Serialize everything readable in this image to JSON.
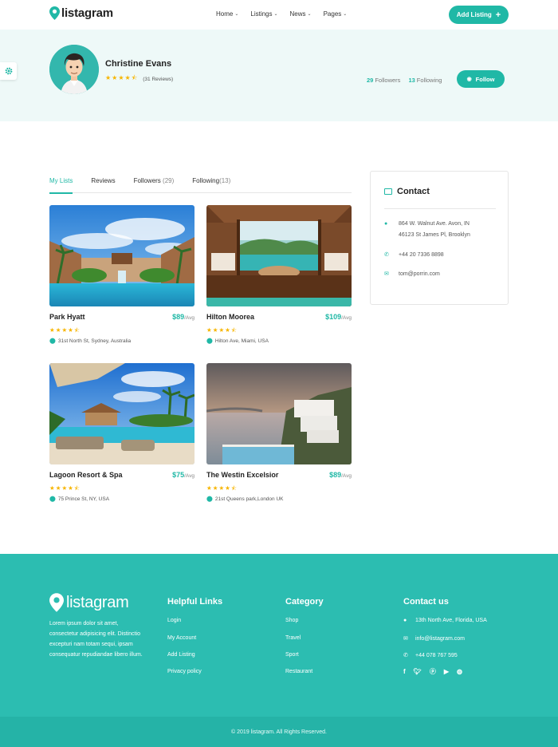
{
  "brand": {
    "name": "listagram",
    "accent": "#20b8a6"
  },
  "nav": {
    "items": [
      {
        "label": "Home"
      },
      {
        "label": "Listings"
      },
      {
        "label": "News"
      },
      {
        "label": "Pages"
      }
    ],
    "add_listing": "Add Listing"
  },
  "profile": {
    "name": "Christine Evans",
    "stars": "★★★★⯪",
    "reviews": "(31 Reviews)",
    "followers_count": "29",
    "followers_label": "Followers",
    "following_count": "13",
    "following_label": "Following",
    "follow_button": "Follow"
  },
  "tabs": [
    {
      "label": "My Lists",
      "count": ""
    },
    {
      "label": "Reviews",
      "count": ""
    },
    {
      "label": "Followers ",
      "count": "(29)"
    },
    {
      "label": "Following",
      "count": "(13)"
    }
  ],
  "listings": [
    {
      "title": "Park Hyatt",
      "price": "$89",
      "unit": "/Avg",
      "stars": "★★★★⯪",
      "address": "31st North St, Sydney, Australia"
    },
    {
      "title": "Hilton Moorea",
      "price": "$109",
      "unit": "/Avg",
      "stars": "★★★★⯪",
      "address": "Hilton Ave, Miami, USA"
    },
    {
      "title": "Lagoon Resort & Spa",
      "price": "$75",
      "unit": "/Avg",
      "stars": "★★★★⯪",
      "address": "75 Prince St, NY, USA"
    },
    {
      "title": "The Westin Excelsior",
      "price": "$89",
      "unit": "/Avg",
      "stars": "★★★★⯪",
      "address": "21st Queens park,London UK"
    }
  ],
  "contact": {
    "title": "Contact",
    "address_line1": "864 W. Walnut Ave. Avon, IN",
    "address_line2": "46123 St James Pl, Brooklyn",
    "phone": "+44 20 7336 8898",
    "email": "tom@porrin.com"
  },
  "footer": {
    "logo": "listagram",
    "about": "Lorem ipsum dolor sit amet, consectetur adipisicing elit. Distinctio excepturi nam totam sequi, ipsam consequatur repudiandae libero illum.",
    "helpful_title": "Helpful Links",
    "helpful_links": [
      "Login",
      "My Account",
      "Add Listing",
      "Privacy policy"
    ],
    "category_title": "Category",
    "categories": [
      "Shop",
      "Travel",
      "Sport",
      "Restaurant"
    ],
    "contact_title": "Contact us",
    "address": "13th North Ave, Florida, USA",
    "email": "info@listagram.com",
    "phone": "+44 078 767 595",
    "copyright": "© 2019 listagram. All Rights Reserved."
  }
}
